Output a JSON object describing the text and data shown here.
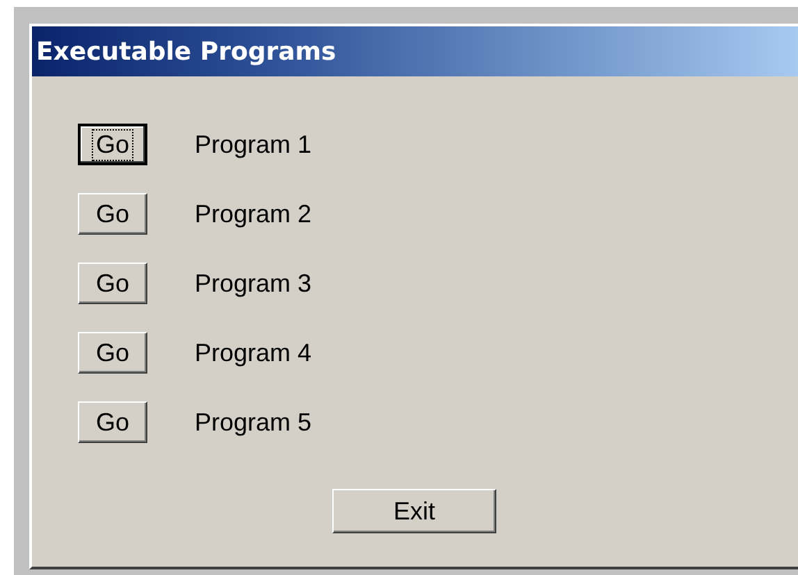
{
  "window": {
    "title": "Executable Programs"
  },
  "programs": [
    {
      "button": "Go",
      "label": "Program 1",
      "focused": true
    },
    {
      "button": "Go",
      "label": "Program 2",
      "focused": false
    },
    {
      "button": "Go",
      "label": "Program 3",
      "focused": false
    },
    {
      "button": "Go",
      "label": "Program 4",
      "focused": false
    },
    {
      "button": "Go",
      "label": "Program 5",
      "focused": false
    }
  ],
  "exit_button": "Exit"
}
